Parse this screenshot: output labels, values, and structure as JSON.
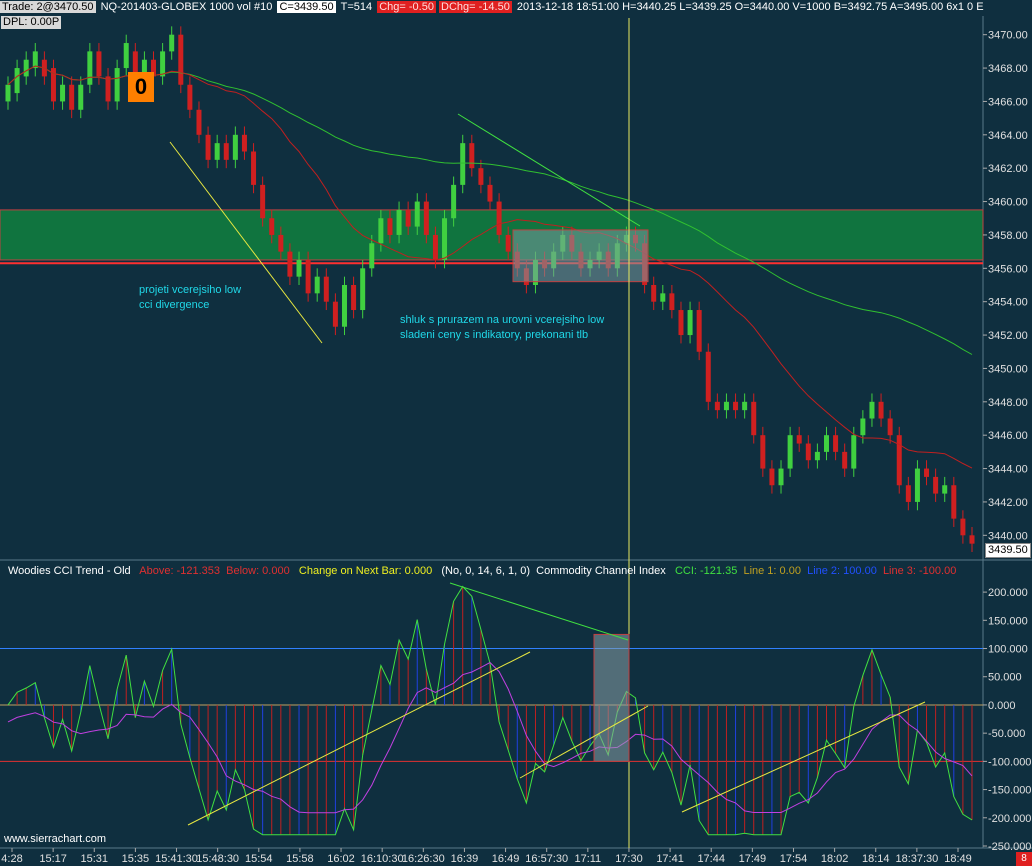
{
  "header": {
    "trade": "Trade: 2@3470.50",
    "symbol": "NQ-201403-GLOBEX  1000 vol  #10",
    "close": "C=3439.50",
    "ticks": "T=514",
    "chg": "Chg= -0.50",
    "dchg": "DChg= -14.50",
    "info": "2013-12-18 18:51:00 H=3440.25 L=3439.25 O=3440.00 V=1000 B=3492.75 A=3495.00 6x1 0 E",
    "dpl": "DPL: 0.00P"
  },
  "badge": "0",
  "notes": {
    "note1": [
      "projeti vcerejsiho low",
      "cci divergence"
    ],
    "note2": [
      "shluk s prurazem na urovni vcerejsiho low",
      "sladeni ceny s indikatory, prekonani tlb"
    ]
  },
  "cci_header": {
    "study": "Woodies CCI Trend - Old",
    "above": "Above: -121.353",
    "below": "Below: 0.000",
    "change": "Change on Next Bar: 0.000",
    "params": "(No, 0, 14, 6, 1, 0)",
    "cci_name": "Commodity Channel Index",
    "cci": "CCI: -121.35",
    "line1": "Line 1: 0.00",
    "line2": "Line 2: 100.00",
    "line3": "Line 3: -100.00"
  },
  "price_axis": [
    "3470.00",
    "3468.00",
    "3466.00",
    "3464.00",
    "3462.00",
    "3460.00",
    "3458.00",
    "3456.00",
    "3454.00",
    "3452.00",
    "3450.00",
    "3448.00",
    "3446.00",
    "3444.00",
    "3442.00",
    "3440.00"
  ],
  "last_price": "3439.50",
  "cci_axis": [
    "200.000",
    "150.000",
    "100.000",
    "50.000",
    "0.000",
    "-50.000",
    "-100.000",
    "-150.000",
    "-200.000",
    "-250.000"
  ],
  "time_axis": [
    "4:28",
    "15:17",
    "15:31",
    "15:35",
    "15:41:30",
    "15:48:30",
    "15:54",
    "15:58",
    "16:02",
    "16:10:30",
    "16:26:30",
    "16:39",
    "16:49",
    "16:57:30",
    "17:11",
    "17:30",
    "17:41",
    "17:44",
    "17:49",
    "17:54",
    "18:02",
    "18:14",
    "18:37:30",
    "18:49"
  ],
  "watermark": "www.sierrachart.com",
  "corner": "8",
  "colors": {
    "bg": "#0f2f3f",
    "up": "#40d040",
    "down": "#d02020",
    "zone": "#108040",
    "ma_green": "#30c030",
    "ma_red": "#c02020",
    "cursor": "#e8e860"
  },
  "chart_data": {
    "type": "candlestick",
    "price_ylim": [
      3439,
      3471
    ],
    "cci_ylim": [
      -250,
      225
    ],
    "zone": [
      3456.5,
      3459.5
    ],
    "support_line": 3456.3,
    "candles": [
      [
        3466,
        3467
      ],
      [
        3466.5,
        3468
      ],
      [
        3467.5,
        3468.5
      ],
      [
        3468,
        3469
      ],
      [
        3468.5,
        3467.5
      ],
      [
        3468,
        3466
      ],
      [
        3466,
        3467
      ],
      [
        3467,
        3465.5
      ],
      [
        3465.5,
        3467
      ],
      [
        3467,
        3469
      ],
      [
        3469,
        3467.5
      ],
      [
        3467.5,
        3466
      ],
      [
        3466,
        3468
      ],
      [
        3468,
        3469.5
      ],
      [
        3469,
        3467
      ],
      [
        3467.5,
        3468.5
      ],
      [
        3468.5,
        3467.5
      ],
      [
        3467.5,
        3469
      ],
      [
        3469,
        3470
      ],
      [
        3470,
        3467
      ],
      [
        3467,
        3465.5
      ],
      [
        3465.5,
        3464
      ],
      [
        3464,
        3462.5
      ],
      [
        3462.5,
        3463.5
      ],
      [
        3463.5,
        3462.5
      ],
      [
        3462.5,
        3464
      ],
      [
        3464,
        3463
      ],
      [
        3463,
        3461
      ],
      [
        3461,
        3459
      ],
      [
        3459,
        3458
      ],
      [
        3458,
        3457
      ],
      [
        3457,
        3455.5
      ],
      [
        3455.5,
        3456.5
      ],
      [
        3456.5,
        3454.5
      ],
      [
        3454.5,
        3455.5
      ],
      [
        3455.5,
        3454
      ],
      [
        3454,
        3452.5
      ],
      [
        3452.5,
        3455
      ],
      [
        3455,
        3453.5
      ],
      [
        3453.5,
        3456
      ],
      [
        3456,
        3457.5
      ],
      [
        3457.5,
        3459
      ],
      [
        3459,
        3458
      ],
      [
        3458,
        3459.5
      ],
      [
        3459.5,
        3458.5
      ],
      [
        3458.5,
        3460
      ],
      [
        3460,
        3458
      ],
      [
        3458,
        3456.5
      ],
      [
        3456.5,
        3459
      ],
      [
        3459,
        3461
      ],
      [
        3461,
        3463.5
      ],
      [
        3463.5,
        3462
      ],
      [
        3462,
        3461
      ],
      [
        3461,
        3460
      ],
      [
        3460,
        3458
      ],
      [
        3458,
        3457
      ],
      [
        3457,
        3456
      ],
      [
        3456,
        3455
      ],
      [
        3455,
        3456.5
      ],
      [
        3456.5,
        3456
      ],
      [
        3456,
        3457
      ],
      [
        3457,
        3458
      ],
      [
        3458,
        3457
      ],
      [
        3457,
        3456
      ],
      [
        3456,
        3456.5
      ],
      [
        3456.5,
        3457
      ],
      [
        3457,
        3456
      ],
      [
        3456,
        3457.5
      ],
      [
        3457.5,
        3458
      ],
      [
        3458,
        3457.5
      ],
      [
        3457.5,
        3455
      ],
      [
        3455,
        3454
      ],
      [
        3454,
        3454.5
      ],
      [
        3454.5,
        3453.5
      ],
      [
        3453.5,
        3452
      ],
      [
        3452,
        3453.5
      ],
      [
        3453.5,
        3451
      ],
      [
        3451,
        3448
      ],
      [
        3448,
        3447.5
      ],
      [
        3447.5,
        3448
      ],
      [
        3448,
        3447.5
      ],
      [
        3447.5,
        3448
      ],
      [
        3448,
        3446
      ],
      [
        3446,
        3444
      ],
      [
        3444,
        3443
      ],
      [
        3443,
        3444
      ],
      [
        3444,
        3446
      ],
      [
        3446,
        3445.5
      ],
      [
        3445.5,
        3444.5
      ],
      [
        3444.5,
        3445
      ],
      [
        3445,
        3446
      ],
      [
        3446,
        3445
      ],
      [
        3445,
        3444
      ],
      [
        3444,
        3446
      ],
      [
        3446,
        3447
      ],
      [
        3447,
        3448
      ],
      [
        3448,
        3447
      ],
      [
        3447,
        3446
      ],
      [
        3446,
        3443
      ],
      [
        3443,
        3442
      ],
      [
        3442,
        3444
      ],
      [
        3444,
        3443.5
      ],
      [
        3443.5,
        3442.5
      ],
      [
        3442.5,
        3443
      ],
      [
        3443,
        3441
      ],
      [
        3441,
        3440
      ],
      [
        3440,
        3439.5
      ]
    ]
  }
}
